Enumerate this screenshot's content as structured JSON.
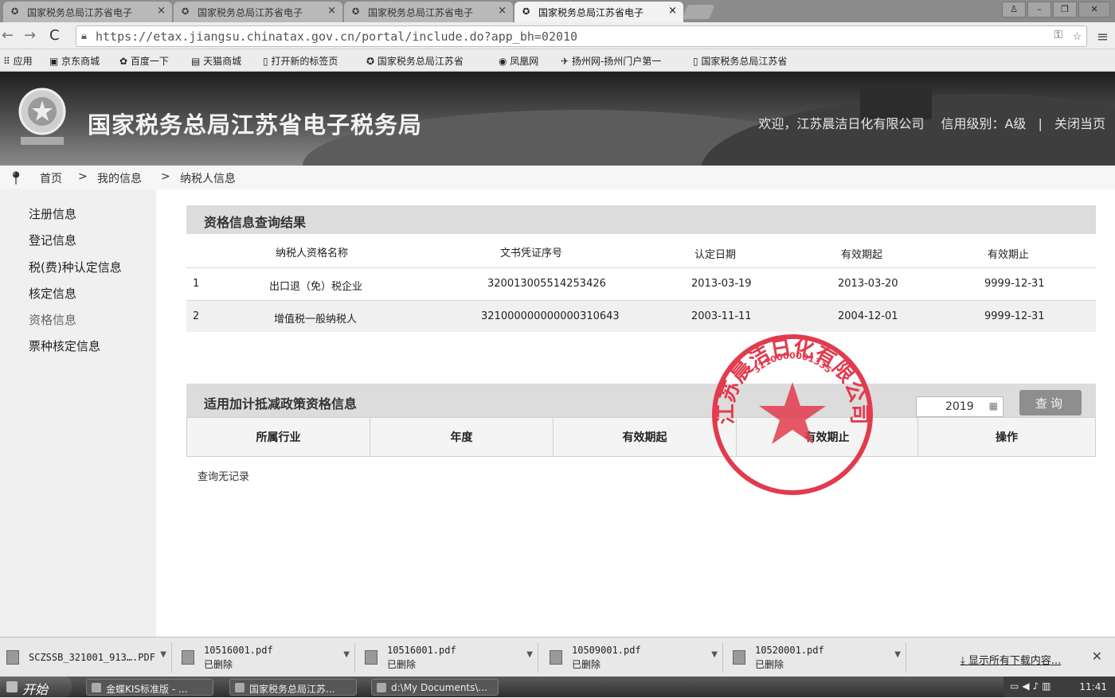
{
  "browser": {
    "tabs": [
      {
        "label": "国家税务总局江苏省电子"
      },
      {
        "label": "国家税务总局江苏省电子"
      },
      {
        "label": "国家税务总局江苏省电子"
      },
      {
        "label": "国家税务总局江苏省电子"
      }
    ],
    "url": "https://etax.jiangsu.chinatax.gov.cn/portal/include.do?app_bh=02010",
    "bookmarks": [
      "应用",
      "京东商城",
      "百度一下",
      "天猫商城",
      "打开新的标签页",
      "国家税务总局江苏省",
      "凤凰网",
      "扬州网-扬州门户第一",
      "国家税务总局江苏省"
    ]
  },
  "header": {
    "site_title": "国家税务总局江苏省电子税务局",
    "welcome": "欢迎，江苏晨洁日化有限公司",
    "credit_level": "信用级别：A级",
    "separator": "|",
    "close_page": "关闭当页"
  },
  "breadcrumb": {
    "home": "首页",
    "sep1": ">",
    "my_info": "我的信息",
    "sep2": ">",
    "current": "纳税人信息"
  },
  "sidebar": {
    "items": [
      {
        "label": "注册信息"
      },
      {
        "label": "登记信息"
      },
      {
        "label": "税(费)种认定信息"
      },
      {
        "label": "核定信息"
      },
      {
        "label": "资格信息"
      },
      {
        "label": "票种核定信息"
      }
    ]
  },
  "qualification": {
    "title": "资格信息查询结果",
    "columns": [
      "纳税人资格名称",
      "文书凭证序号",
      "认定日期",
      "有效期起",
      "有效期止"
    ],
    "rows": [
      {
        "index": "1",
        "name": "出口退（免）税企业",
        "doc_no": "320013005514253426",
        "date": "2013-03-19",
        "start": "2013-03-20",
        "end": "9999-12-31"
      },
      {
        "index": "2",
        "name": "增值税一般纳税人",
        "doc_no": "321000000000000310643",
        "date": "2003-11-11",
        "start": "2004-12-01",
        "end": "9999-12-31"
      }
    ]
  },
  "policy": {
    "title": "适用加计抵减政策资格信息",
    "year_value": "2019",
    "query_button": "查询",
    "columns": [
      "所属行业",
      "年度",
      "有效期起",
      "有效期止",
      "操作"
    ],
    "no_record": "查询无记录"
  },
  "seal": {
    "top_text": "江苏晨洁日化有限公司",
    "code_text": "3210000001335",
    "color": "#e23b4e"
  },
  "downloads": {
    "items": [
      {
        "name": "SCZSSB_321001_913….PDF",
        "status": ""
      },
      {
        "name": "10516001.pdf",
        "status": "已删除"
      },
      {
        "name": "10516001.pdf",
        "status": "已删除"
      },
      {
        "name": "10509001.pdf",
        "status": "已删除"
      },
      {
        "name": "10520001.pdf",
        "status": "已删除"
      }
    ],
    "show_all": "显示所有下载内容..."
  },
  "taskbar": {
    "start": "开始",
    "tasks": [
      "金蝶KIS标准版 - ...",
      "国家税务总局江苏...",
      "d:\\My Documents\\..."
    ],
    "clock": "11:41"
  }
}
